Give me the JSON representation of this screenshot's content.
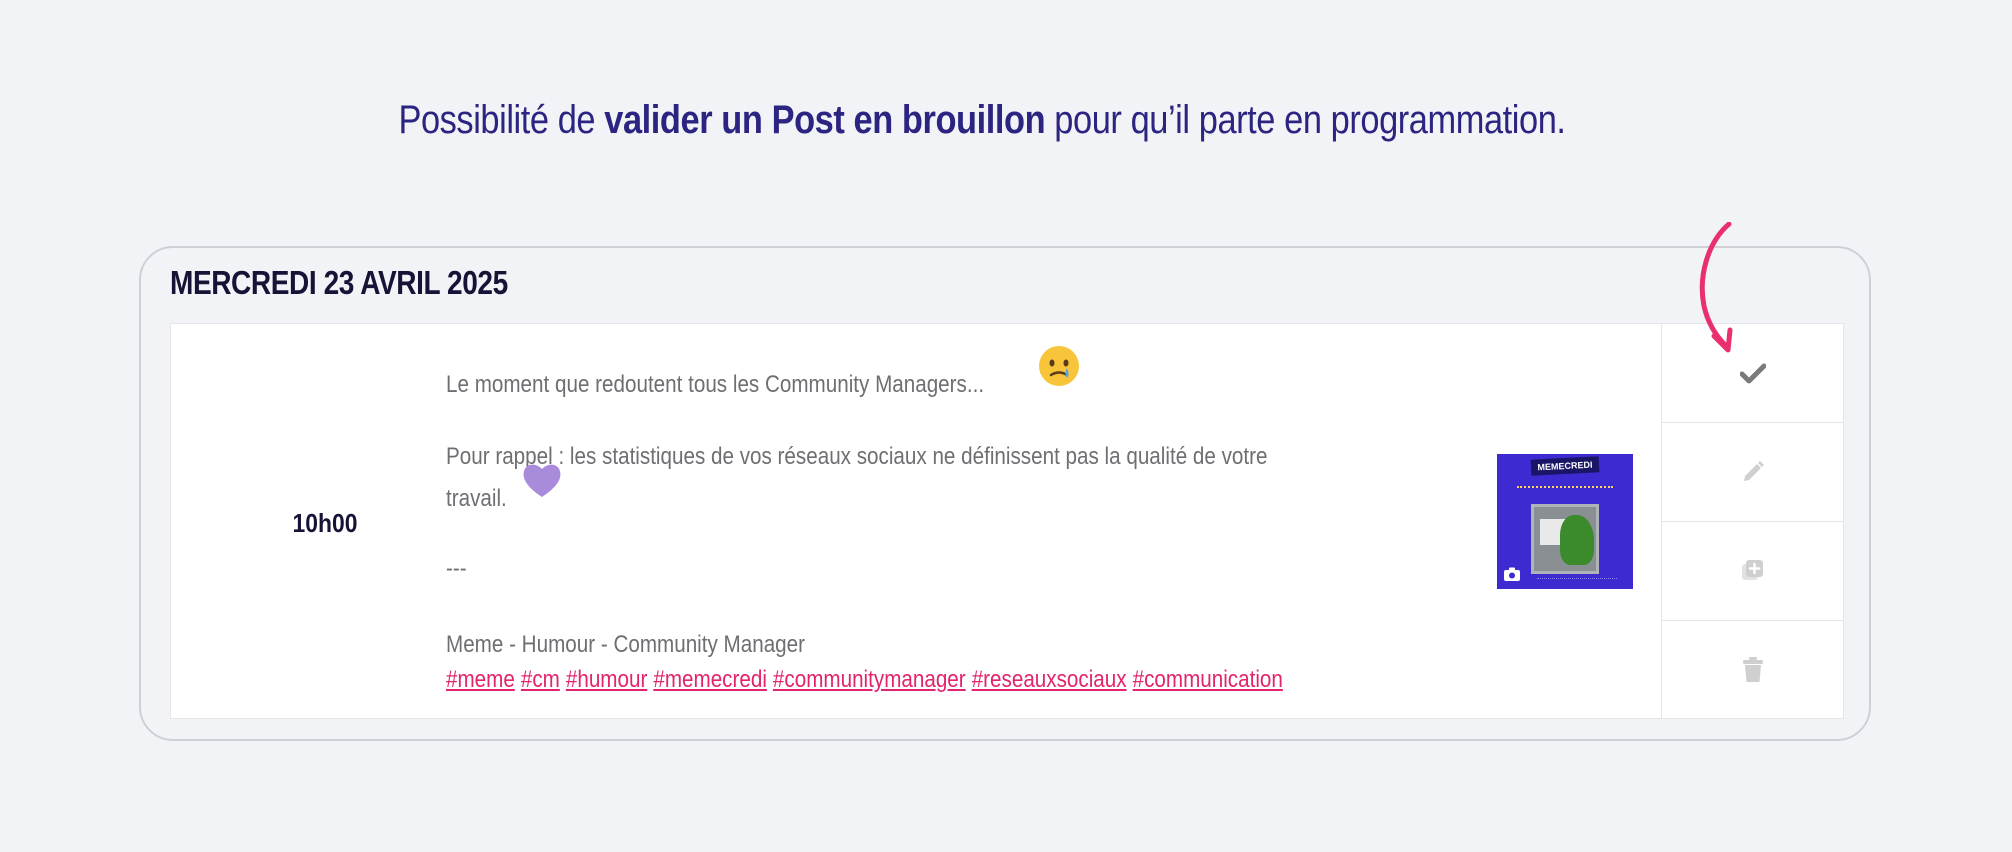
{
  "headline": {
    "prefix": "Possibilité de ",
    "bold": "valider un Post en brouillon",
    "suffix": " pour qu’il parte en programmation."
  },
  "schedule": {
    "date": "MERCREDI 23 AVRIL 2025",
    "post": {
      "time": "10h00",
      "lines": [
        "Le moment que redoutent tous les Community Managers...",
        "Pour rappel : les statistiques de vos réseaux sociaux ne définissent pas la qualité de votre",
        "travail.",
        "---",
        "Meme - Humour - Community Manager"
      ],
      "hashtags": [
        "#meme",
        "#cm",
        "#humour",
        "#memecredi",
        "#communitymanager",
        "#reseauxsociaux",
        "#communication"
      ],
      "thumbnail": {
        "banner": "MEMECREDI"
      }
    }
  },
  "icons": {
    "validate": "check-icon",
    "edit": "pencil-icon",
    "duplicate": "duplicate-icon",
    "delete": "trash-icon",
    "media_type": "camera-icon",
    "emoji_1": "face-holding-back-tears-emoji",
    "emoji_2": "purple-heart-emoji"
  },
  "colors": {
    "headline": "#2b2480",
    "hashtag": "#e2246f",
    "arrow": "#e8306f",
    "action_active": "#7a7a7a",
    "action_inactive": "#cfcfcf"
  }
}
